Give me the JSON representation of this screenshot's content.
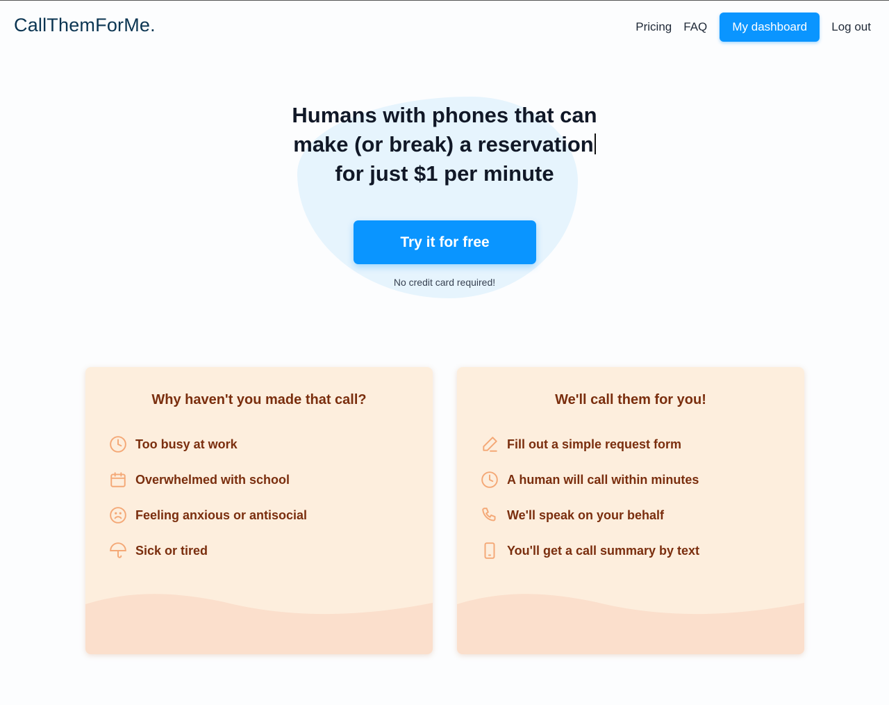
{
  "nav": {
    "logo": "CallThemForMe.",
    "links": [
      "Pricing",
      "FAQ"
    ],
    "dashboard_button": "My dashboard",
    "logout": "Log out"
  },
  "hero": {
    "title_line1": "Humans with phones that can",
    "title_line2": "make (or break) a reservation",
    "title_line3": "for just $1 per minute",
    "cta": "Try it for free",
    "note": "No credit card required!"
  },
  "cards": [
    {
      "title": "Why haven't you made that call?",
      "items": [
        {
          "icon": "clock-icon",
          "text": "Too busy at work"
        },
        {
          "icon": "calendar-icon",
          "text": "Overwhelmed with school"
        },
        {
          "icon": "sad-face-icon",
          "text": "Feeling anxious or antisocial"
        },
        {
          "icon": "umbrella-icon",
          "text": "Sick or tired"
        }
      ]
    },
    {
      "title": "We'll call them for you!",
      "items": [
        {
          "icon": "pencil-icon",
          "text": "Fill out a simple request form"
        },
        {
          "icon": "clock-icon",
          "text": "A human will call within minutes"
        },
        {
          "icon": "phone-icon",
          "text": "We'll speak on your behalf"
        },
        {
          "icon": "mobile-icon",
          "text": "You'll get a call summary by text"
        }
      ]
    }
  ],
  "colors": {
    "accent": "#0a95ff",
    "card_bg": "#fdeedd",
    "card_text": "#7a2e0e",
    "icon": "#f4a876",
    "blob": "#e6f4fd"
  }
}
